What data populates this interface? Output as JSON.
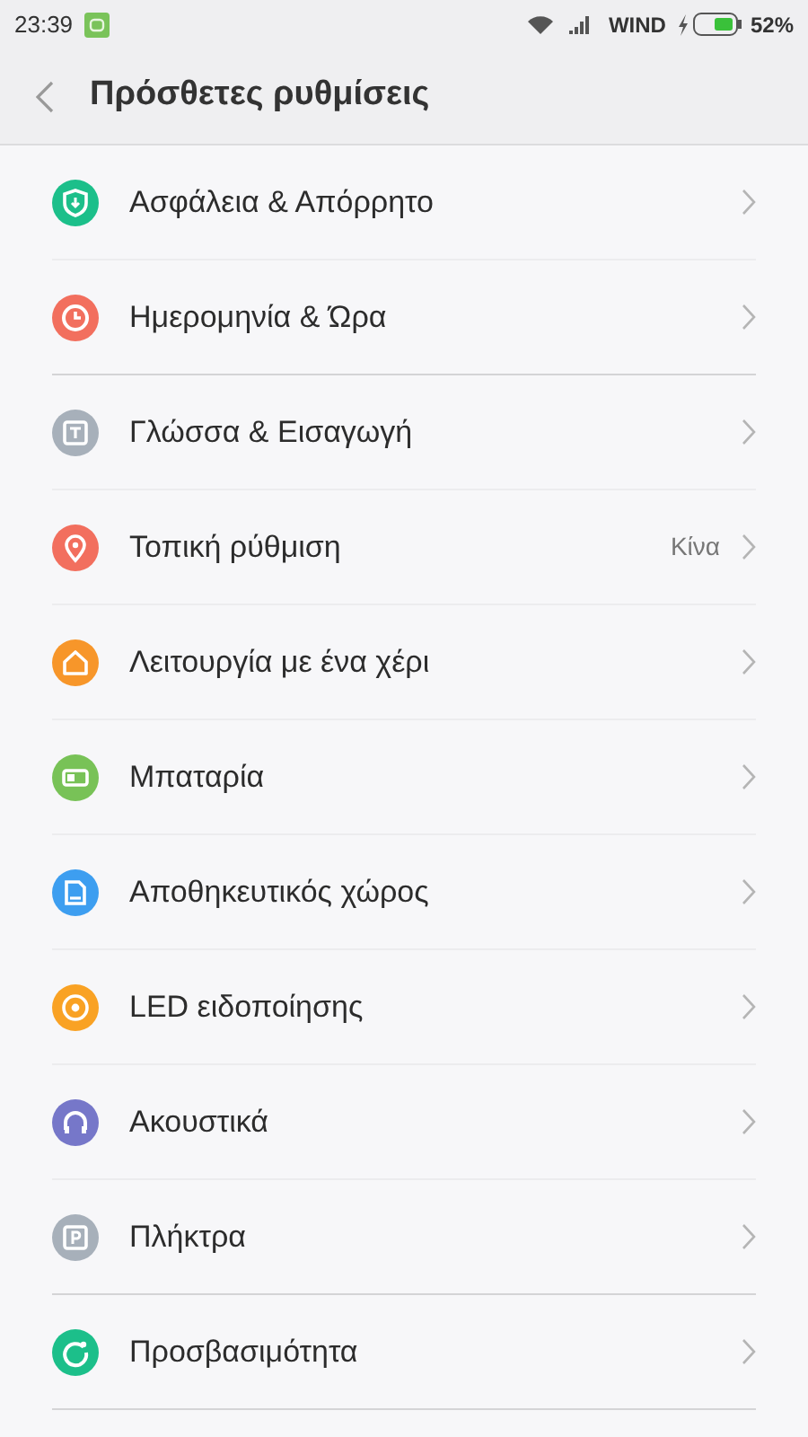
{
  "status_bar": {
    "time": "23:39",
    "carrier": "WIND",
    "battery": "52%"
  },
  "header": {
    "title": "Πρόσθετες ρυθμίσεις"
  },
  "sections": [
    {
      "items": [
        {
          "label": "Ασφάλεια & Απόρρητο",
          "kind": "shield",
          "color": "#1cbf8a"
        },
        {
          "label": "Ημερομηνία & Ώρα",
          "kind": "clock",
          "color": "#f26f5e"
        }
      ]
    },
    {
      "items": [
        {
          "label": "Γλώσσα & Εισαγωγή",
          "kind": "text",
          "color": "#a7b0ba"
        },
        {
          "label": "Τοπική ρύθμιση",
          "kind": "pin",
          "color": "#f26f5e",
          "value": "Κίνα"
        },
        {
          "label": "Λειτουργία με ένα χέρι",
          "kind": "home",
          "color": "#f7962a"
        },
        {
          "label": "Μπαταρία",
          "kind": "battery",
          "color": "#78c257"
        },
        {
          "label": "Αποθηκευτικός χώρος",
          "kind": "card",
          "color": "#3d9ef0"
        },
        {
          "label": "LED ειδοποίησης",
          "kind": "led",
          "color": "#f9a224"
        },
        {
          "label": "Ακουστικά",
          "kind": "headphones",
          "color": "#7677c9"
        },
        {
          "label": "Πλήκτρα",
          "kind": "key",
          "color": "#a7b0ba"
        }
      ]
    },
    {
      "items": [
        {
          "label": "Προσβασιμότητα",
          "kind": "refresh",
          "color": "#1cbf8a"
        }
      ]
    }
  ]
}
